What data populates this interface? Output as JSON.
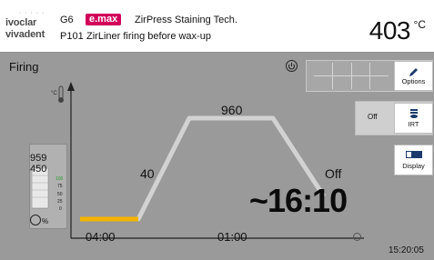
{
  "header": {
    "logo_line1": "ivoclar",
    "logo_line2": "vivadent",
    "program_group": "G6",
    "program_number": "P101",
    "brand_badge": "e.max",
    "program_title": "ZirPress Staining Tech.",
    "program_name": "ZirLiner firing before wax-up",
    "temperature": "403",
    "temperature_unit": "°C",
    "brand_color": "#d1005a"
  },
  "screen": {
    "title": "Firing"
  },
  "side_buttons": {
    "options_label": "Options",
    "irt_label": "IRT",
    "irt_state": "Off",
    "display_label": "Display"
  },
  "chart_data": {
    "type": "line",
    "y_unit_icon": "°C thermometer-icon",
    "hold_temp_label": "960",
    "rate_label": "40",
    "cooling_label": "Off",
    "countdown": "~16:10",
    "time_start": "04:00",
    "time_hold": "01:00",
    "temp_readout_a": "959",
    "temp_readout_b": "450",
    "vacuum_levels": [
      "100",
      "75",
      "50",
      "25",
      "0"
    ],
    "percent_label": "%",
    "progress_color": "#f4b400",
    "line_color": "#d2d2d2"
  },
  "status": {
    "clock": "15:20:05"
  }
}
